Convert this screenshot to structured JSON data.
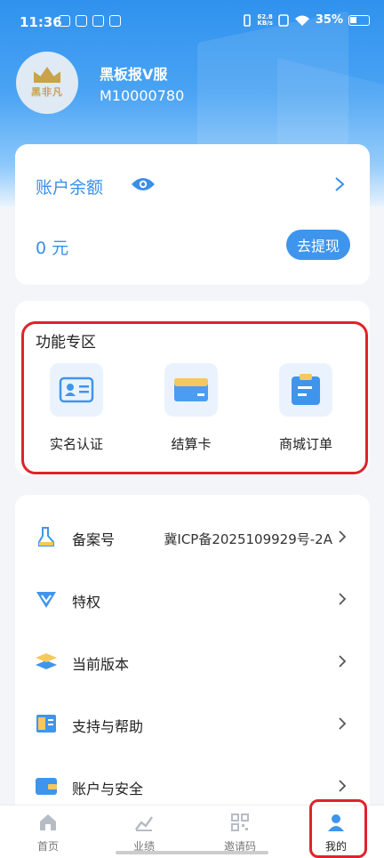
{
  "status_bar": {
    "time": "11:36",
    "speed_value": "62.8",
    "speed_unit": "KB/s",
    "battery": "35%"
  },
  "profile": {
    "name": "黑板报V服",
    "id": "M10000780",
    "avatar_logo_text": "黑非凡"
  },
  "balance": {
    "label": "账户余额",
    "amount": "0 元",
    "withdraw_label": "去提现"
  },
  "features": {
    "title": "功能专区",
    "items": [
      {
        "label": "实名认证",
        "icon": "id-card-icon"
      },
      {
        "label": "结算卡",
        "icon": "bank-card-icon"
      },
      {
        "label": "商城订单",
        "icon": "order-clipboard-icon"
      }
    ]
  },
  "menu": {
    "items": [
      {
        "label": "备案号",
        "value": "冀ICP备2025109929号-2A",
        "icon": "filing-icon"
      },
      {
        "label": "特权",
        "value": "",
        "icon": "privilege-icon"
      },
      {
        "label": "当前版本",
        "value": "",
        "icon": "layers-icon"
      },
      {
        "label": "支持与帮助",
        "value": "",
        "icon": "help-book-icon"
      },
      {
        "label": "账户与安全",
        "value": "",
        "icon": "wallet-icon"
      }
    ]
  },
  "tabbar": {
    "items": [
      {
        "label": "首页",
        "icon": "home-icon"
      },
      {
        "label": "业绩",
        "icon": "chart-icon"
      },
      {
        "label": "邀请码",
        "icon": "qrcode-icon"
      },
      {
        "label": "我的",
        "icon": "user-icon"
      }
    ]
  },
  "colors": {
    "accent": "#3f95ec",
    "highlight": "#e0222a"
  }
}
